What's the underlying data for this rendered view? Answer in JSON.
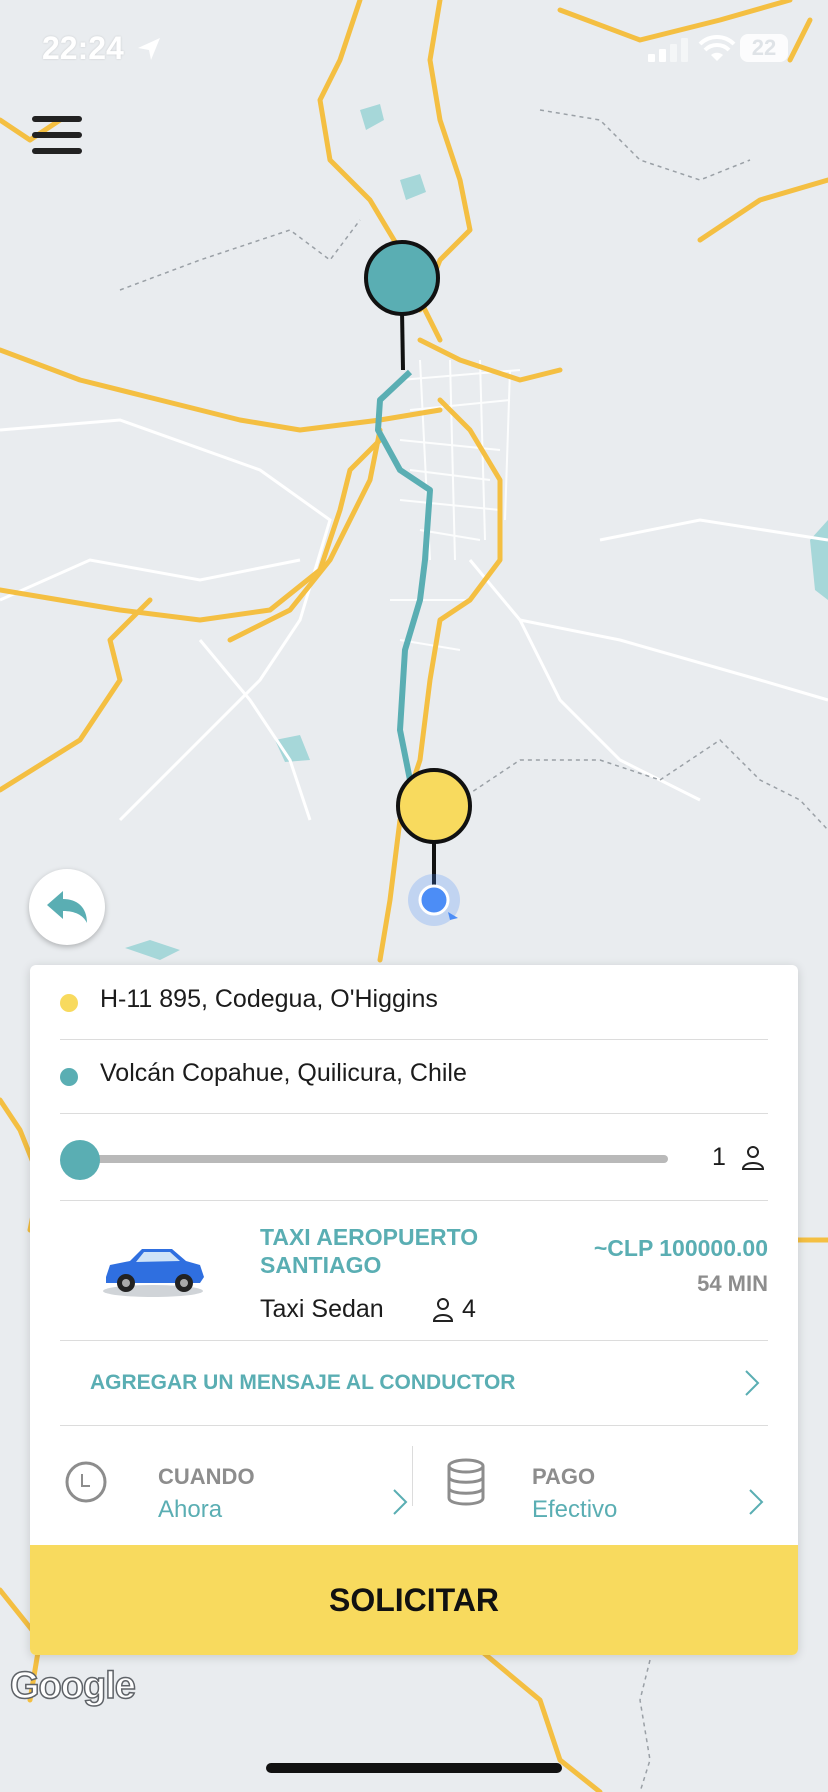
{
  "status_bar": {
    "time": "22:24",
    "battery": "22"
  },
  "colors": {
    "accent": "#5aaeb3",
    "pickup_marker": "#f8da5e",
    "destination_marker": "#5aaeb3",
    "button": "#f8da5e"
  },
  "icons": {
    "menu": "menu-icon",
    "back": "back-arrow-icon",
    "location": "location-arrow-icon",
    "clock": "clock-icon",
    "payment": "coins-icon",
    "person": "person-icon",
    "chevron": "chevron-right-icon"
  },
  "map": {
    "attribution": "Google"
  },
  "trip": {
    "pickup": "H-11 895, Codegua, O'Higgins",
    "destination": "Volcán Copahue, Quilicura, Chile"
  },
  "passengers": {
    "count": "1"
  },
  "vehicle": {
    "name": "TAXI AEROPUERTO SANTIAGO",
    "type": "Taxi Sedan",
    "capacity": "4",
    "price": "~CLP 100000.00",
    "duration": "54 MIN"
  },
  "message": {
    "label": "AGREGAR UN MENSAJE AL CONDUCTOR"
  },
  "when": {
    "label": "CUANDO",
    "value": "Ahora"
  },
  "payment": {
    "label": "PAGO",
    "value": "Efectivo"
  },
  "request_button": {
    "label": "SOLICITAR"
  }
}
